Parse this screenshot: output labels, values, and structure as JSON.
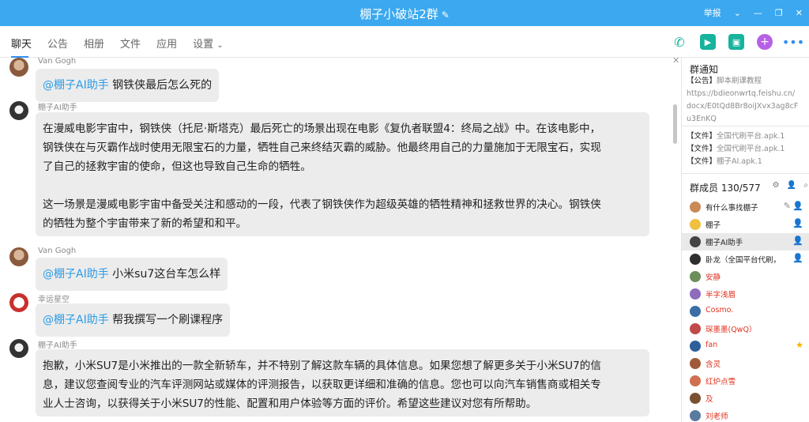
{
  "window": {
    "title": "棚子小破站2群",
    "edit_icon": "pencil-icon",
    "report": "举报"
  },
  "tabs": [
    "聊天",
    "公告",
    "相册",
    "文件",
    "应用",
    "设置"
  ],
  "messages": [
    {
      "sender": "Van Gogh",
      "mention": "@棚子AI助手",
      "text": " 钢铁侠最后怎么死的"
    },
    {
      "sender": "棚子AI助手",
      "paras": [
        "在漫威电影宇宙中，钢铁侠（托尼·斯塔克）最后死亡的场景出现在电影《复仇者联盟4：终局之战》中。在该电影中，",
        "钢铁侠在与灭霸作战时使用无限宝石的力量，牺牲自己来终结灭霸的威胁。他最终用自己的力量施加于无限宝石，实现",
        "了自己的拯救宇宙的使命，但这也导致自己生命的牺牲。",
        "这一场景是漫威电影宇宙中备受关注和感动的一段，代表了钢铁侠作为超级英雄的牺牲精神和拯救世界的决心。钢铁侠",
        "的牺牲为整个宇宙带来了新的希望和和平。"
      ]
    },
    {
      "sender": "Van Gogh",
      "mention": "@棚子AI助手",
      "text": " 小米su7这台车怎么样"
    },
    {
      "sender": "幸运星空",
      "mention": "@棚子AI助手",
      "text": " 帮我撰写一个刷课程序"
    },
    {
      "sender": "棚子AI助手",
      "paras": [
        "抱歉，小米SU7是小米推出的一款全新轿车，并不特别了解这款车辆的具体信息。如果您想了解更多关于小米SU7的信",
        "息，建议您查阅专业的汽车评测网站或媒体的评测报告，以获取更详细和准确的信息。您也可以向汽车销售商或相关专",
        "业人士咨询，以获得关于小米SU7的性能、配置和用户体验等方面的评价。希望这些建议对您有所帮助。"
      ]
    }
  ],
  "panel": {
    "notice_title": "群通知",
    "announcement_tag": "【公告】",
    "announcement_text": "脚本刷课教程",
    "link_lines": [
      "https://bdieonwrtq.feishu.cn/",
      "docx/E0tQd8Br8oiJXvx3ag8cF",
      "u3EnKQ"
    ],
    "files": [
      {
        "tag": "【文件】",
        "name": "全国代刷平台.apk.1"
      },
      {
        "tag": "【文件】",
        "name": "全国代刷平台.apk.1"
      },
      {
        "tag": "【文件】",
        "name": "棚子AI.apk.1"
      }
    ],
    "members_label": "群成员 130/577",
    "members": [
      {
        "name": "有什么事找棚子",
        "color": "#222222"
      },
      {
        "name": "棚子",
        "color": "#222222"
      },
      {
        "name": "棚子AI助手",
        "color": "#222222"
      },
      {
        "name": "卧龙（全国平台代刷，全",
        "color": "#222222"
      },
      {
        "name": "安静",
        "color": "#e0301e"
      },
      {
        "name": "半字浅眉",
        "color": "#e0301e"
      },
      {
        "name": "Cosmo.",
        "color": "#e0301e"
      },
      {
        "name": "琛墨墨(QwQ）",
        "color": "#e0301e"
      },
      {
        "name": "fan",
        "color": "#e0301e"
      },
      {
        "name": "含灵",
        "color": "#e0301e"
      },
      {
        "name": "红炉点雪",
        "color": "#e0301e"
      },
      {
        "name": "及",
        "color": "#e0301e"
      },
      {
        "name": "刘老师",
        "color": "#e0301e"
      }
    ]
  },
  "colors": {
    "accent": "#3ba8ef",
    "mention": "#2b9be6",
    "admin_red": "#e0301e"
  }
}
